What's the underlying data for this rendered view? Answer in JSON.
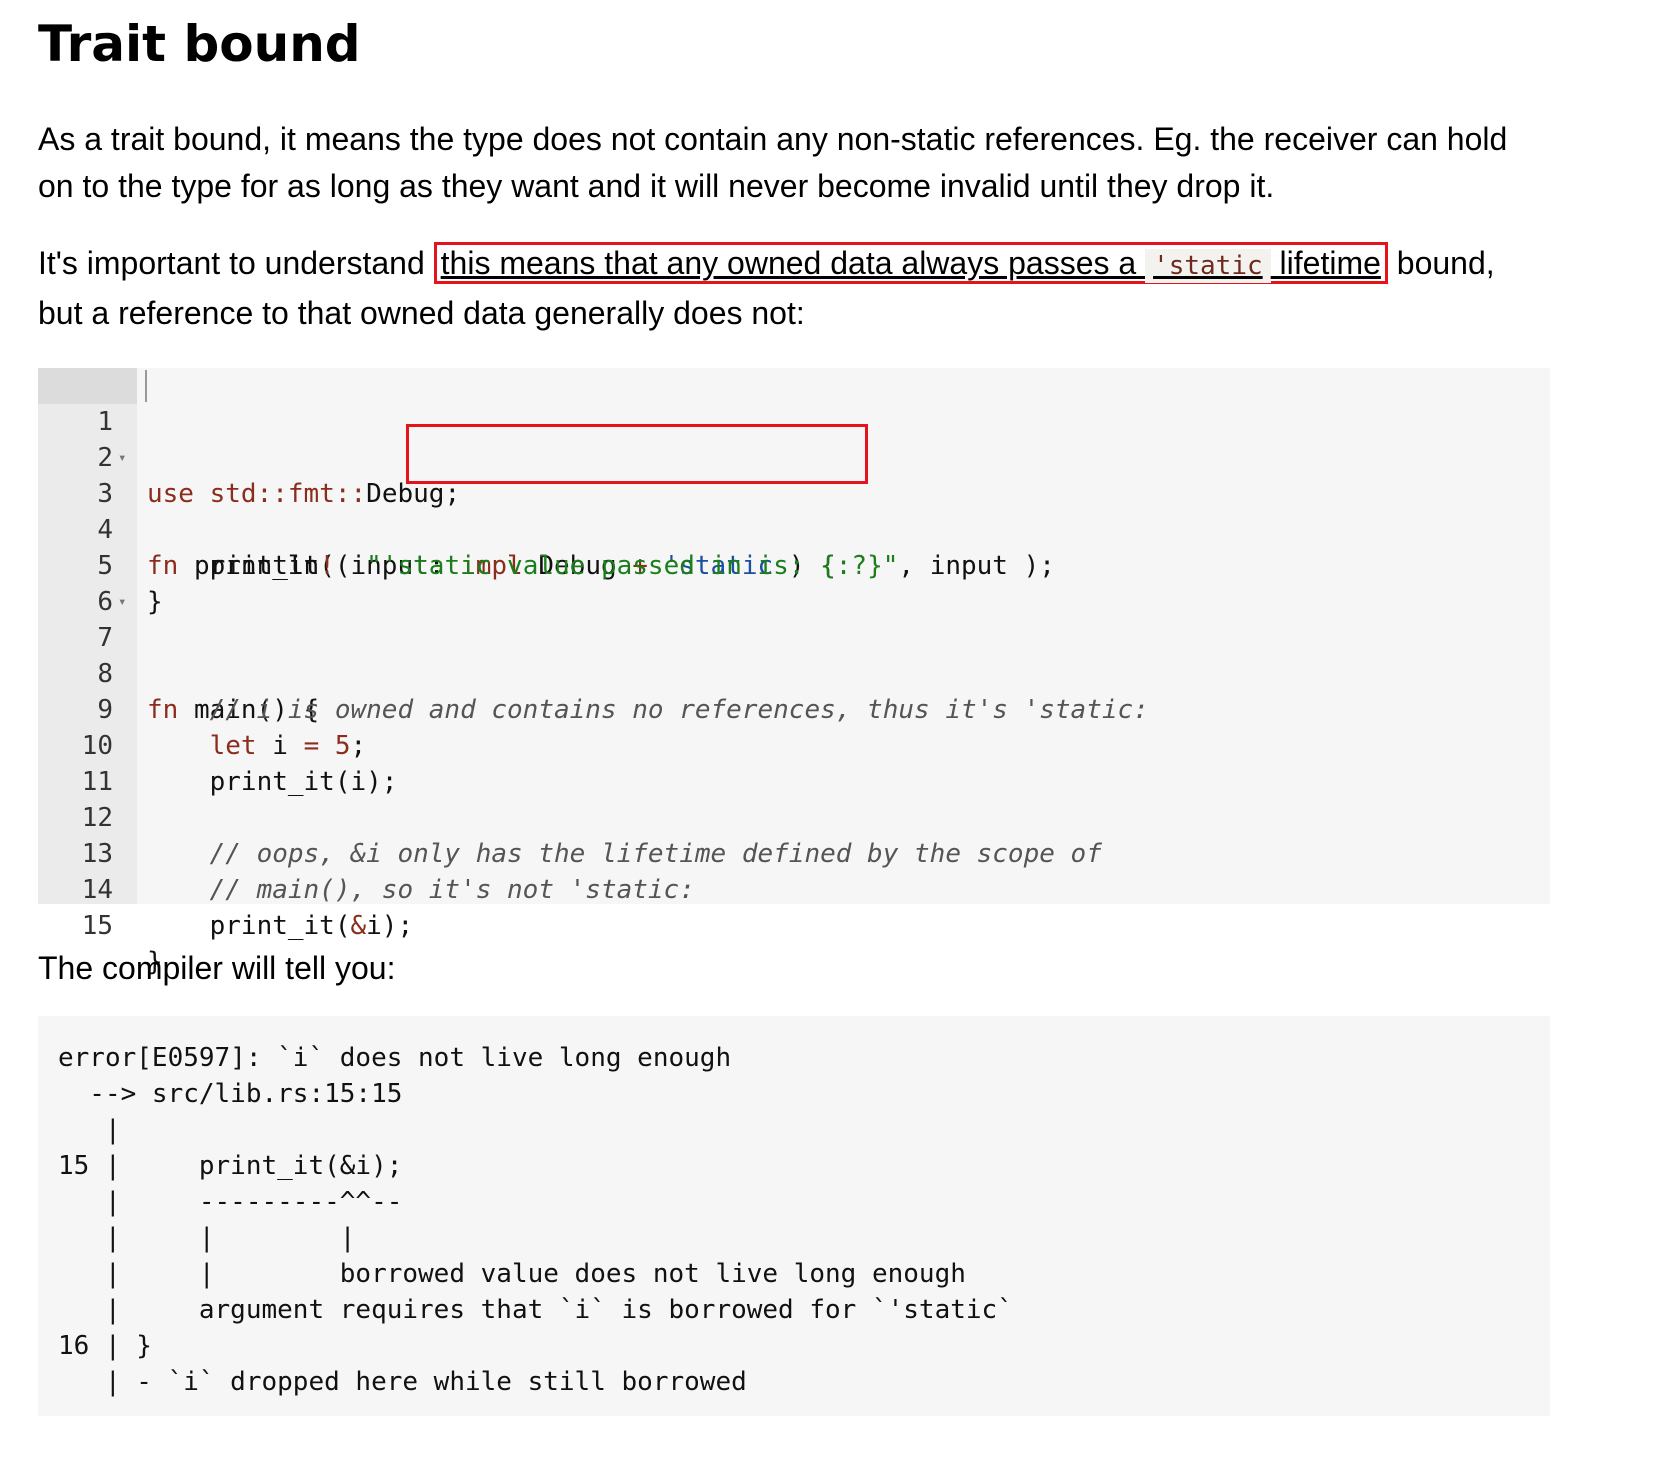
{
  "heading": "Trait bound",
  "para1": "As a trait bound, it means the type does not contain any non-static references. Eg. the receiver can hold on to the type for as long as they want and it will never become invalid until they drop it.",
  "para2": {
    "before": "It's important to understand ",
    "highlight_text": "this means that any owned data always passes a ",
    "inline_code": "'static",
    "highlight_after": " lifetime",
    "after": " bound, but a reference to that owned data generally does not:"
  },
  "code": {
    "line_numbers": [
      "1",
      "2",
      "3",
      "4",
      "5",
      "6",
      "7",
      "8",
      "9",
      "10",
      "11",
      "12",
      "13",
      "14",
      "15"
    ],
    "fold_marker": "▾",
    "l1": {
      "kw": "use",
      "path": "std::fmt::",
      "rest": "Debug;"
    },
    "l3": {
      "kw": "fn",
      "name": " print_it( ",
      "param": "input: ",
      "impl": "impl",
      "type": " Debug ",
      "plus": "+",
      "lt": " 'static",
      "close": " ) {"
    },
    "l4": {
      "indent": "    ",
      "macro": "println",
      "bang": "!",
      "open": "( ",
      "str": "\"'static value passed in is: {:?}\"",
      "rest": ", input );"
    },
    "l5": "}",
    "l7": {
      "kw": "fn",
      "rest": " main() {"
    },
    "l8": "    // i is owned and contains no references, thus it's 'static:",
    "l9": {
      "indent": "    ",
      "kw": "let",
      "mid": " i ",
      "eq": "=",
      "num": " 5",
      "end": ";"
    },
    "l10": "    print_it(i);",
    "l12": "    // oops, &i only has the lifetime defined by the scope of",
    "l13": "    // main(), so it's not 'static:",
    "l14": {
      "pre": "    print_it(",
      "amp": "&",
      "post": "i);"
    },
    "l15": "}"
  },
  "para3": "The compiler will tell you:",
  "error_output": [
    "error[E0597]: `i` does not live long enough",
    "  --> src/lib.rs:15:15",
    "   |",
    "15 |     print_it(&i);",
    "   |     ---------^^--",
    "   |     |        |",
    "   |     |        borrowed value does not live long enough",
    "   |     argument requires that `i` is borrowed for `'static`",
    "16 | }",
    "   | - `i` dropped here while still borrowed"
  ],
  "colors": {
    "highlight_border": "#e5141b",
    "code_bg": "#f6f6f6",
    "gutter_bg": "#ebebeb"
  }
}
